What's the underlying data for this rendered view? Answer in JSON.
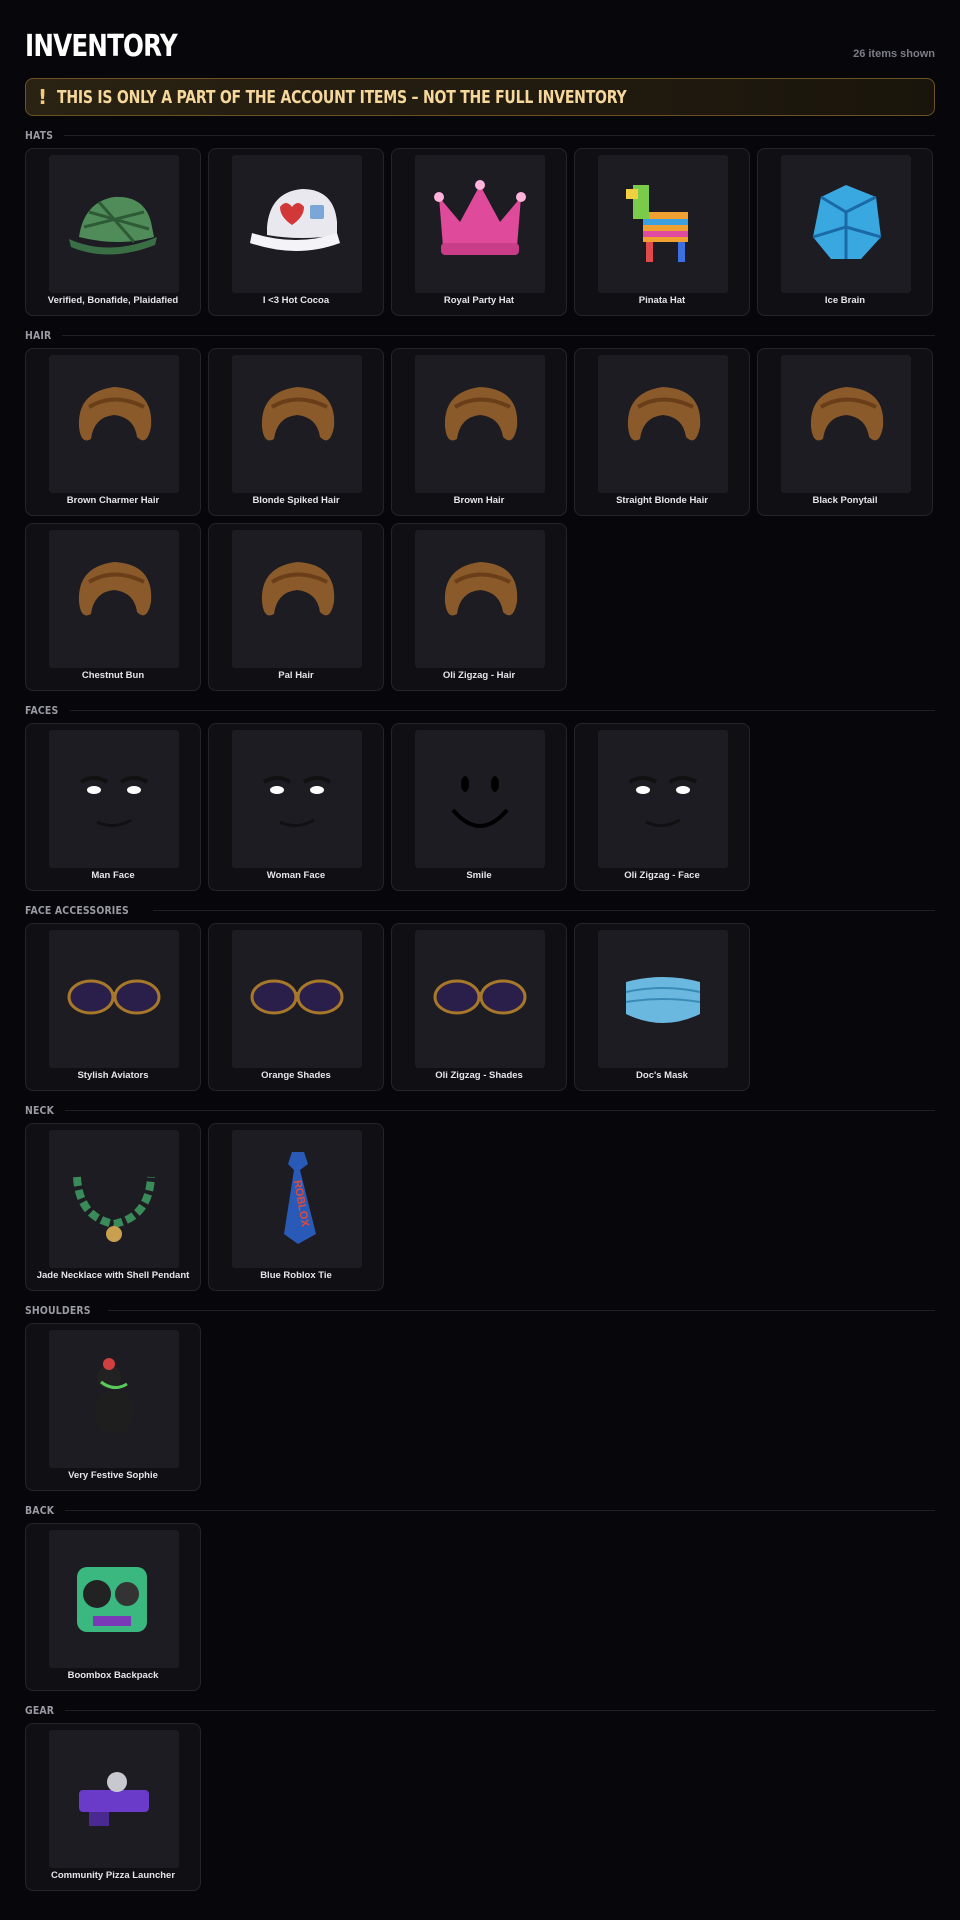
{
  "header": {
    "title": "INVENTORY",
    "count": "26 items shown"
  },
  "warning": {
    "icon": "!",
    "text": "THIS IS ONLY A PART OF THE ACCOUNT ITEMS – NOT THE FULL INVENTORY"
  },
  "sections": [
    {
      "label": "HATS",
      "items": [
        {
          "name": "Verified, Bonafide, Plaidafied",
          "icon": "plaid-cap-icon"
        },
        {
          "name": "I <3 Hot Cocoa",
          "icon": "cocoa-cap-icon"
        },
        {
          "name": "Royal Party Hat",
          "icon": "crown-icon"
        },
        {
          "name": "Pinata Hat",
          "icon": "pinata-icon"
        },
        {
          "name": "Ice Brain",
          "icon": "ice-brain-icon"
        }
      ]
    },
    {
      "label": "HAIR",
      "items": [
        {
          "name": "Brown Charmer Hair",
          "icon": "hair-icon"
        },
        {
          "name": "Blonde Spiked Hair",
          "icon": "hair-icon"
        },
        {
          "name": "Brown Hair",
          "icon": "hair-icon"
        },
        {
          "name": "Straight Blonde Hair",
          "icon": "hair-icon"
        },
        {
          "name": "Black Ponytail",
          "icon": "hair-icon"
        },
        {
          "name": "Chestnut Bun",
          "icon": "hair-icon"
        },
        {
          "name": "Pal Hair",
          "icon": "hair-icon"
        },
        {
          "name": "Oli Zigzag - Hair",
          "icon": "hair-icon"
        }
      ]
    },
    {
      "label": "FACES",
      "items": [
        {
          "name": "Man Face",
          "icon": "face-icon"
        },
        {
          "name": "Woman Face",
          "icon": "face-icon"
        },
        {
          "name": "Smile",
          "icon": "smile-icon"
        },
        {
          "name": "Oli Zigzag - Face",
          "icon": "face-icon"
        }
      ]
    },
    {
      "label": "FACE ACCESSORIES",
      "items": [
        {
          "name": "Stylish Aviators",
          "icon": "glasses-icon"
        },
        {
          "name": "Orange Shades",
          "icon": "glasses-icon"
        },
        {
          "name": "Oli Zigzag - Shades",
          "icon": "glasses-icon"
        },
        {
          "name": "Doc's Mask",
          "icon": "mask-icon"
        }
      ]
    },
    {
      "label": "NECK",
      "items": [
        {
          "name": "Jade Necklace with Shell Pendant",
          "icon": "necklace-icon"
        },
        {
          "name": "Blue Roblox Tie",
          "icon": "tie-icon"
        }
      ]
    },
    {
      "label": "SHOULDERS",
      "items": [
        {
          "name": "Very Festive Sophie",
          "icon": "dog-icon"
        }
      ]
    },
    {
      "label": "BACK",
      "items": [
        {
          "name": "Boombox Backpack",
          "icon": "boombox-icon"
        }
      ]
    },
    {
      "label": "GEAR",
      "items": [
        {
          "name": "Community Pizza Launcher",
          "icon": "launcher-icon"
        }
      ]
    }
  ]
}
